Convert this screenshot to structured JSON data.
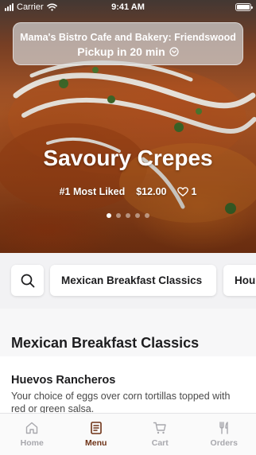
{
  "status_bar": {
    "carrier": "Carrier",
    "time": "9:41 AM"
  },
  "pickup": {
    "store_name": "Mama's Bistro Cafe and Bakery: Friendswood",
    "pickup_label": "Pickup in 20 min"
  },
  "featured": {
    "title": "Savoury Crepes",
    "badge": "#1 Most Liked",
    "price": "$12.00",
    "likes": "1",
    "carousel": {
      "total": 5,
      "active_index": 0
    }
  },
  "category_bar": {
    "search_icon": "search-icon",
    "categories": [
      "Mexican Breakfast Classics",
      "Hou"
    ]
  },
  "section": {
    "title": "Mexican Breakfast Classics",
    "items": [
      {
        "name": "Huevos Rancheros",
        "description": "Your choice of eggs over corn tortillas topped with red or green salsa."
      }
    ]
  },
  "tab_bar": {
    "active": "Menu",
    "tabs": [
      {
        "label": "Home",
        "icon": "home-icon"
      },
      {
        "label": "Menu",
        "icon": "menu-book-icon"
      },
      {
        "label": "Cart",
        "icon": "cart-icon"
      },
      {
        "label": "Orders",
        "icon": "utensils-icon"
      }
    ]
  },
  "colors": {
    "accent": "#6e3216",
    "inactive_tab": "#a8a8ad"
  }
}
